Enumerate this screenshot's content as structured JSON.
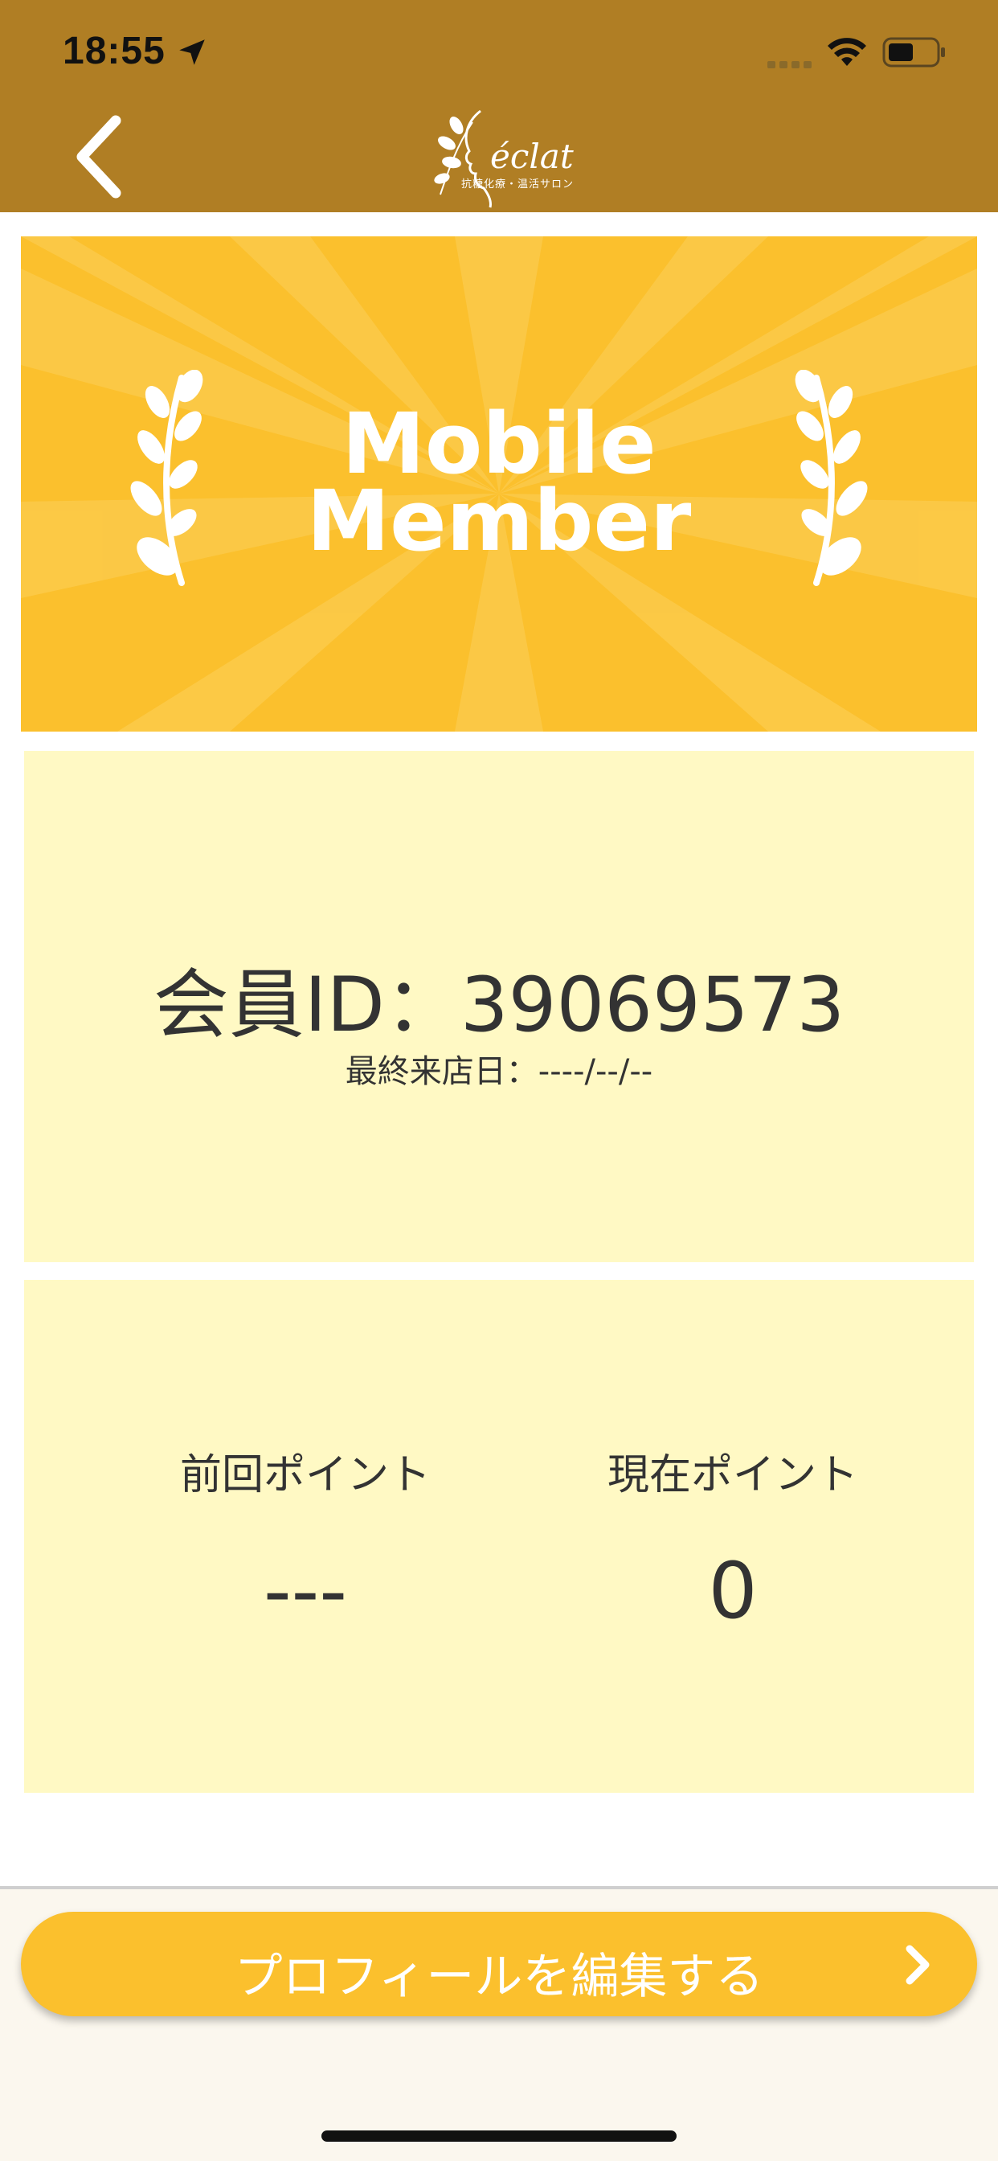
{
  "status_bar": {
    "time": "18:55"
  },
  "nav": {
    "logo_text": "éclat",
    "logo_subtitle": "抗糖化療・温活サロン"
  },
  "banner": {
    "line1": "Mobile",
    "line2": "Member",
    "background_color": "#fbc02d"
  },
  "member_card": {
    "id_label": "会員ID：",
    "id_value": "39069573",
    "last_visit": "最終来店日：----/--/--"
  },
  "points": {
    "previous_label": "前回ポイント",
    "previous_value": "---",
    "current_label": "現在ポイント",
    "current_value": "0"
  },
  "edit_profile_button": {
    "label": "プロフィールを編集する"
  },
  "colors": {
    "header": "#b07e24",
    "accent": "#fbc02d",
    "card_bg": "#fff9c4"
  }
}
